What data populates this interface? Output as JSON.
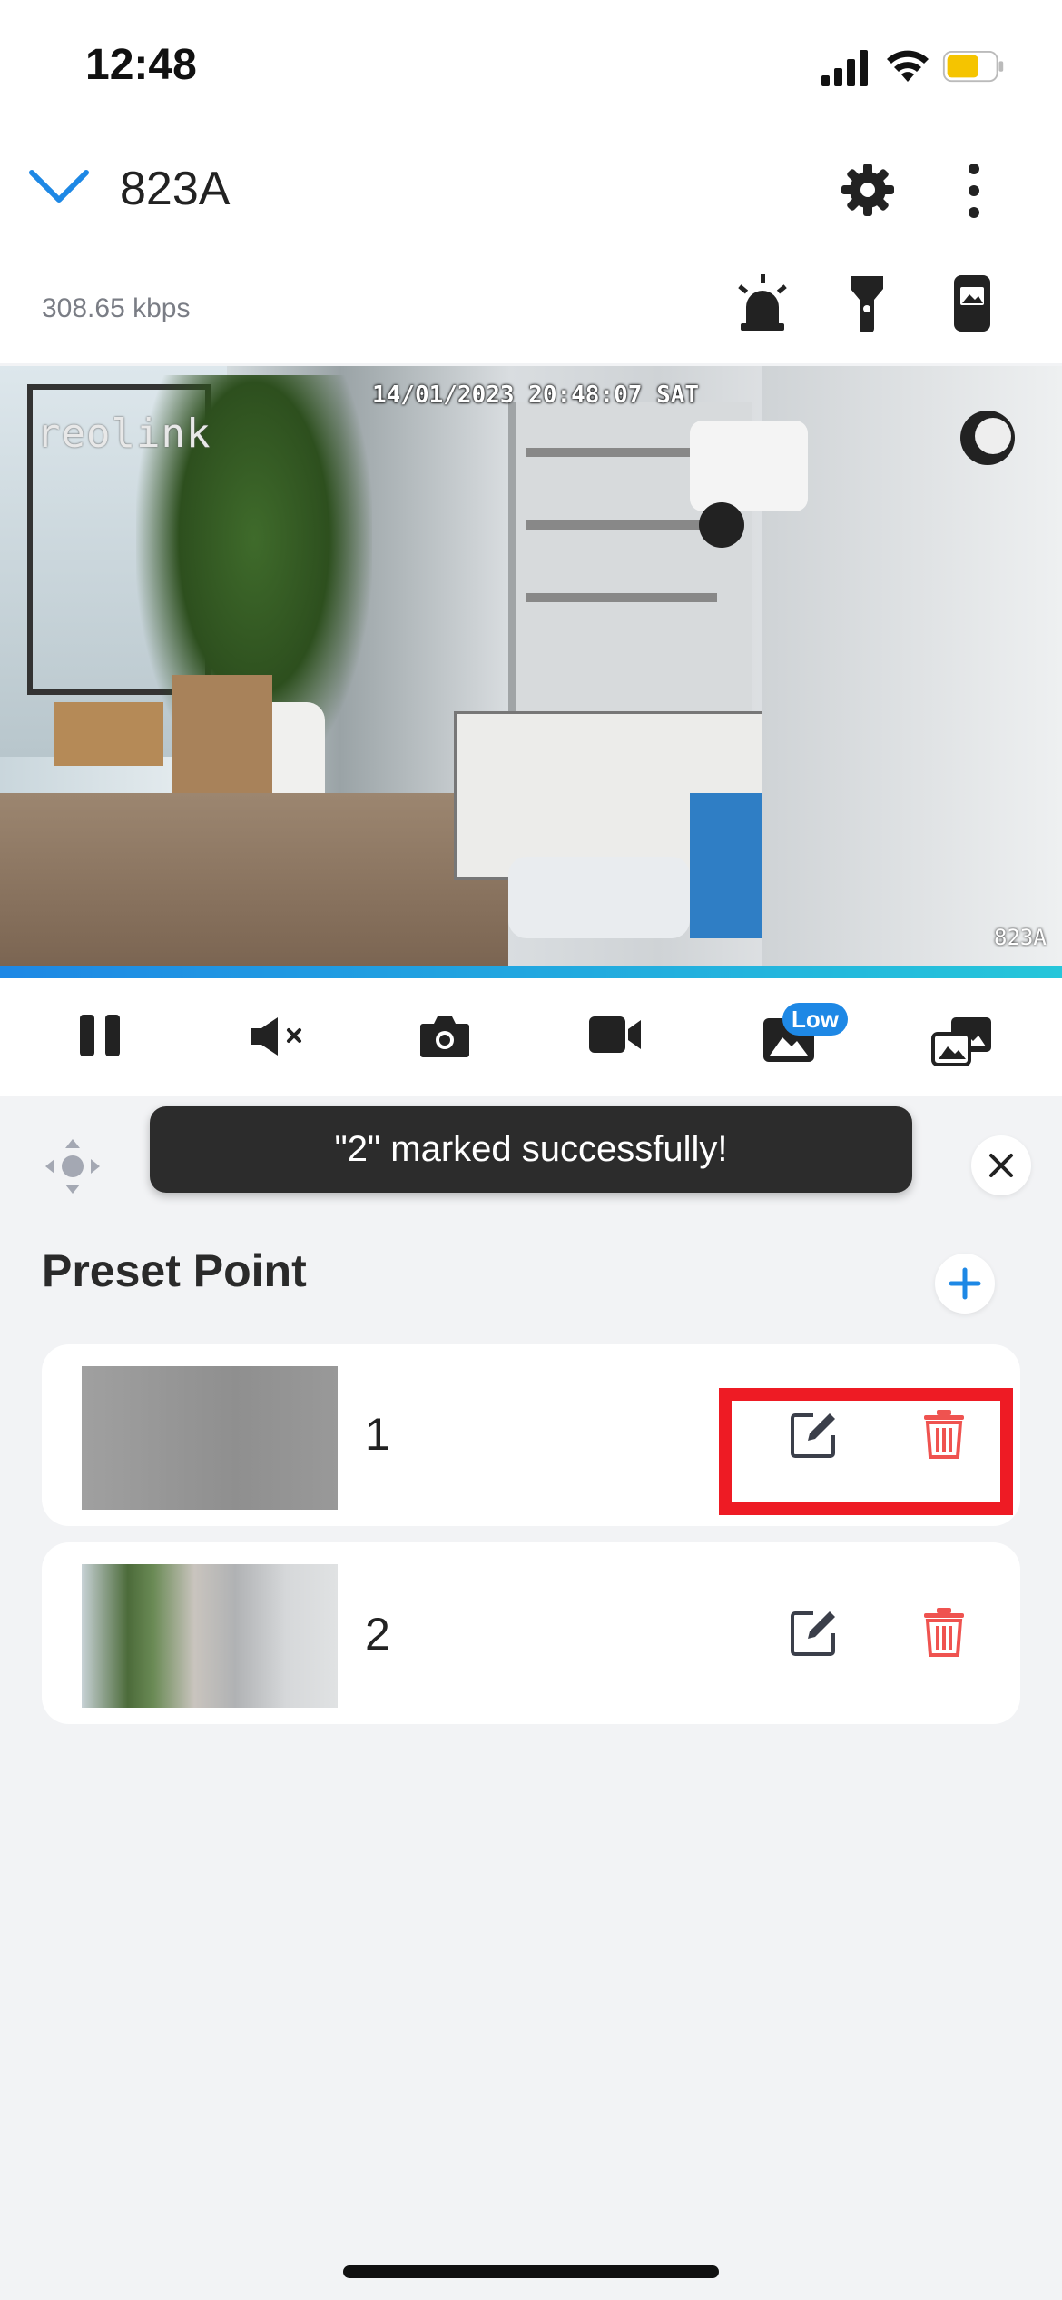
{
  "status_bar": {
    "time": "12:48"
  },
  "header": {
    "title": "823A",
    "bitrate": "308.65 kbps"
  },
  "video": {
    "osd_timestamp": "14/01/2023 20:48:07 SAT",
    "osd_logo": "reolink",
    "osd_name": "823A"
  },
  "controls": {
    "low_badge": "Low"
  },
  "toast": {
    "message": "\"2\" marked successfully!"
  },
  "presets": {
    "title": "Preset Point",
    "items": [
      {
        "label": "1"
      },
      {
        "label": "2"
      }
    ]
  },
  "colors": {
    "accent": "#1e88e5",
    "delete": "#ef5350",
    "highlight": "#ee1b24",
    "toast_bg": "#2c2c2c"
  },
  "icons": [
    "chevron-down-icon",
    "gear-icon",
    "more-vertical-icon",
    "siren-icon",
    "flashlight-icon",
    "phone-icon",
    "pause-icon",
    "mute-icon",
    "camera-icon",
    "video-record-icon",
    "image-quality-icon",
    "picture-in-picture-icon",
    "ptz-dpad-icon",
    "close-icon",
    "plus-icon",
    "edit-icon",
    "trash-icon"
  ]
}
